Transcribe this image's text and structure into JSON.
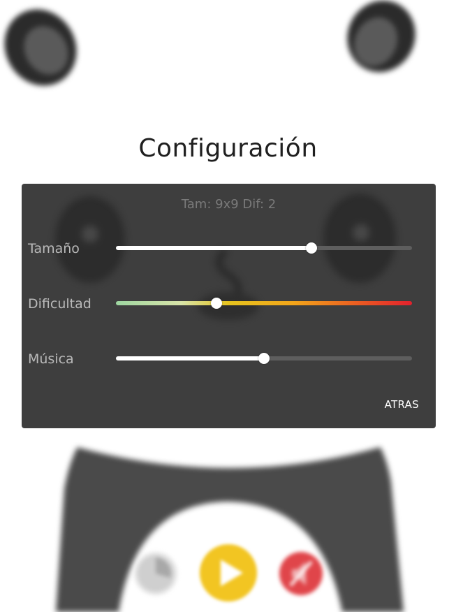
{
  "screen": {
    "title": "Configuración"
  },
  "settings": {
    "summary": "Tam: 9x9 Dif: 2",
    "rows": [
      {
        "label": "Tamaño",
        "value": 0.66
      },
      {
        "label": "Dificultad",
        "value": 0.34
      },
      {
        "label": "Música",
        "value": 0.5
      }
    ],
    "back_label": "ATRAS"
  },
  "colors": {
    "panel": "#363636",
    "difficulty_gradient": [
      "#9ed6a1",
      "#e6c31e",
      "#e2212d"
    ],
    "play_button": "#f2c522",
    "sound_button": "#e0454a"
  },
  "bottom_buttons": {
    "left_icon": "stats-icon",
    "center_icon": "play-icon",
    "right_icon": "sound-muted-icon"
  }
}
